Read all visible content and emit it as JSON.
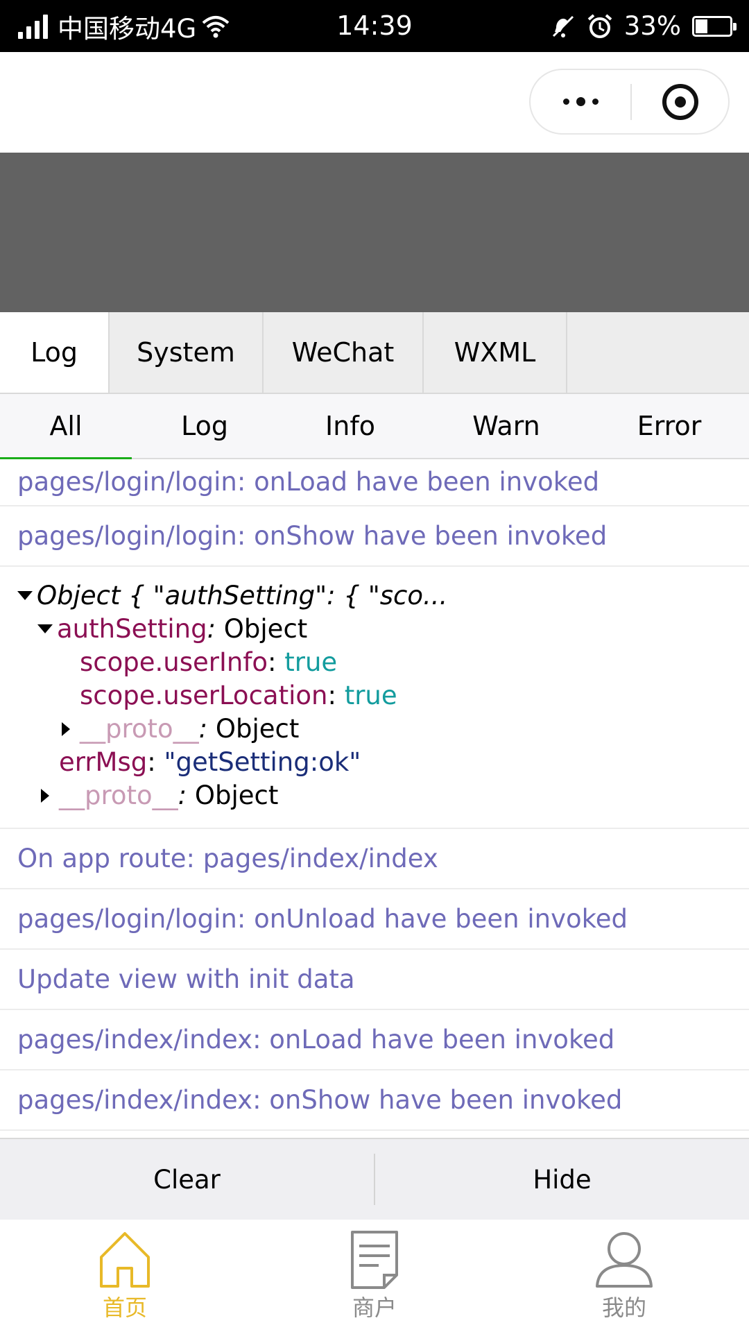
{
  "status_bar": {
    "carrier": "中国移动4G",
    "time": "14:39",
    "battery": "33%",
    "battery_level": 0.33
  },
  "console": {
    "tabs": [
      {
        "label": "Log",
        "active": true
      },
      {
        "label": "System",
        "active": false
      },
      {
        "label": "WeChat",
        "active": false
      },
      {
        "label": "WXML",
        "active": false
      }
    ],
    "filters": [
      {
        "label": "All",
        "active": true
      },
      {
        "label": "Log",
        "active": false
      },
      {
        "label": "Info",
        "active": false
      },
      {
        "label": "Warn",
        "active": false
      },
      {
        "label": "Error",
        "active": false
      }
    ],
    "logs_before": [
      "pages/login/login: onLoad have been invoked",
      "pages/login/login: onShow have been invoked"
    ],
    "object": {
      "summary": "Object { \"authSetting\": { \"sco...",
      "auth_key": "authSetting",
      "colon": ":",
      "object_word": "Object",
      "user_info_key": "scope.userInfo",
      "user_info_val": "true",
      "user_location_key": "scope.userLocation",
      "user_location_val": "true",
      "proto_key": "__proto__",
      "errmsg_key": "errMsg",
      "errmsg_val": "\"getSetting:ok\""
    },
    "logs_after": [
      "On app route: pages/index/index",
      "pages/login/login: onUnload have been invoked",
      "Update view with init data",
      "pages/index/index: onLoad have been invoked",
      "pages/index/index: onShow have been invoked"
    ],
    "clear_label": "Clear",
    "hide_label": "Hide"
  },
  "tab_bar": {
    "items": [
      {
        "label": "首页",
        "icon": "home-icon",
        "active": true
      },
      {
        "label": "商户",
        "icon": "document-icon",
        "active": false
      },
      {
        "label": "我的",
        "icon": "user-icon",
        "active": false
      }
    ],
    "active_color": "#e8b928",
    "inactive_color": "#8a8a8a"
  }
}
